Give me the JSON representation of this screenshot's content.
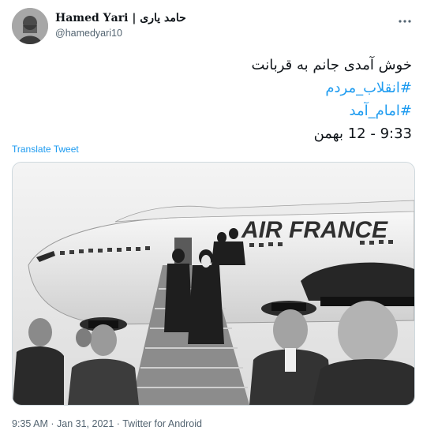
{
  "tweet": {
    "author": {
      "display_name": "𝐇𝐚𝐦𝐞𝐝 𝐘𝐚𝐫𝐢 | حامد یاری",
      "handle": "@hamedyari10",
      "avatar_icon": "profile-photo"
    },
    "more_icon": "ellipsis-horizontal-icon",
    "text_lines": [
      {
        "text": "خوش آمدی جانم به قربانت",
        "type": "text"
      },
      {
        "text": "#انقلاب_مردم",
        "type": "hashtag"
      },
      {
        "text": "#امام_آمد",
        "type": "hashtag"
      },
      {
        "text": "9:33 - 12 بهمن",
        "type": "text"
      }
    ],
    "translate_label": "Translate Tweet",
    "media": {
      "description_icon": "photo",
      "fuselage_text": "AIR FRANCE"
    },
    "metadata": {
      "time": "9:35 AM",
      "separator": "·",
      "date": "Jan 31, 2021",
      "source": "Twitter for Android"
    }
  },
  "colors": {
    "link": "#1d9bf0",
    "secondary_text": "#536471",
    "primary_text": "#0f1419",
    "border": "#cfd9de"
  }
}
